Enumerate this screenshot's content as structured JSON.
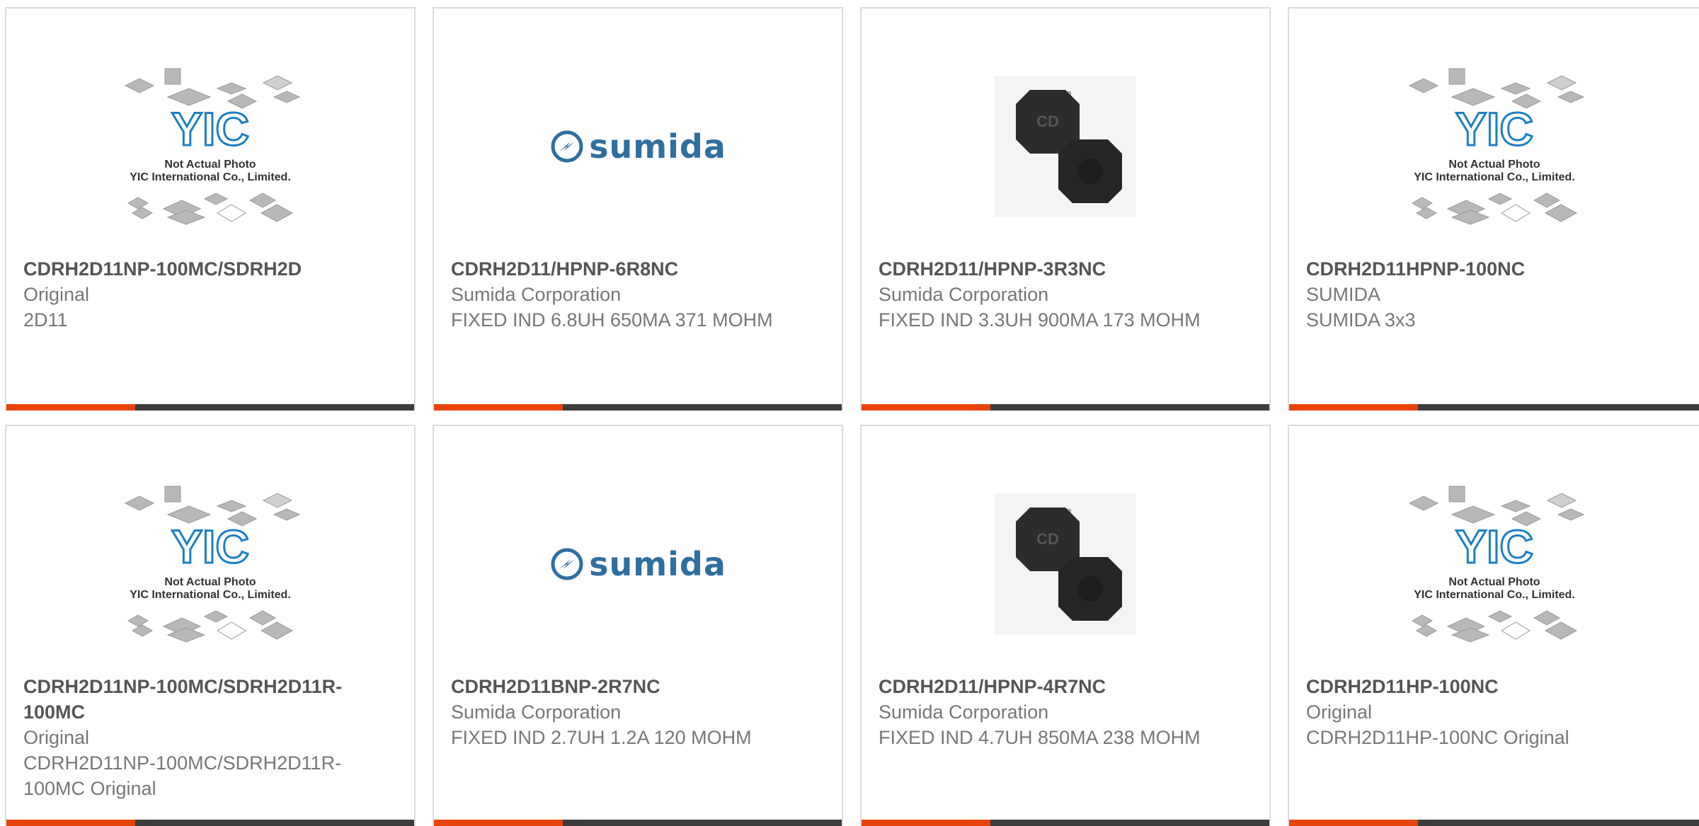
{
  "colors": {
    "accent": "#e8430a",
    "bar": "#3c3c3c",
    "sumida_blue": "#2f6fa0",
    "yic_blue": "#1d7fc4"
  },
  "yic_caption": {
    "line1": "Not Actual Photo",
    "line2": "YIC International Co., Limited."
  },
  "sumida_logo": {
    "wordmark": "sumida"
  },
  "inductor_photo": {
    "marking": "CD"
  },
  "products": [
    {
      "image": "yic-placeholder",
      "part_number": "CDRH2D11NP-100MC/SDRH2D",
      "manufacturer": "Original",
      "description": "2D11"
    },
    {
      "image": "sumida-logo",
      "part_number": "CDRH2D11/HPNP-6R8NC",
      "manufacturer": "Sumida Corporation",
      "description": "FIXED IND 6.8UH 650MA 371 MOHM"
    },
    {
      "image": "inductor-photo",
      "part_number": "CDRH2D11/HPNP-3R3NC",
      "manufacturer": "Sumida Corporation",
      "description": "FIXED IND 3.3UH 900MA 173 MOHM"
    },
    {
      "image": "yic-placeholder",
      "part_number": "CDRH2D11HPNP-100NC",
      "manufacturer": "SUMIDA",
      "description": "SUMIDA 3x3"
    },
    {
      "image": "yic-placeholder",
      "part_number": "CDRH2D11NP-100MC/SDRH2D11R-100MC",
      "manufacturer": "Original",
      "description": "CDRH2D11NP-100MC/SDRH2D11R-100MC Original"
    },
    {
      "image": "sumida-logo",
      "part_number": "CDRH2D11BNP-2R7NC",
      "manufacturer": "Sumida Corporation",
      "description": "FIXED IND 2.7UH 1.2A 120 MOHM"
    },
    {
      "image": "inductor-photo",
      "part_number": "CDRH2D11/HPNP-4R7NC",
      "manufacturer": "Sumida Corporation",
      "description": "FIXED IND 4.7UH 850MA 238 MOHM"
    },
    {
      "image": "yic-placeholder",
      "part_number": "CDRH2D11HP-100NC",
      "manufacturer": "Original",
      "description": "CDRH2D11HP-100NC Original"
    }
  ]
}
